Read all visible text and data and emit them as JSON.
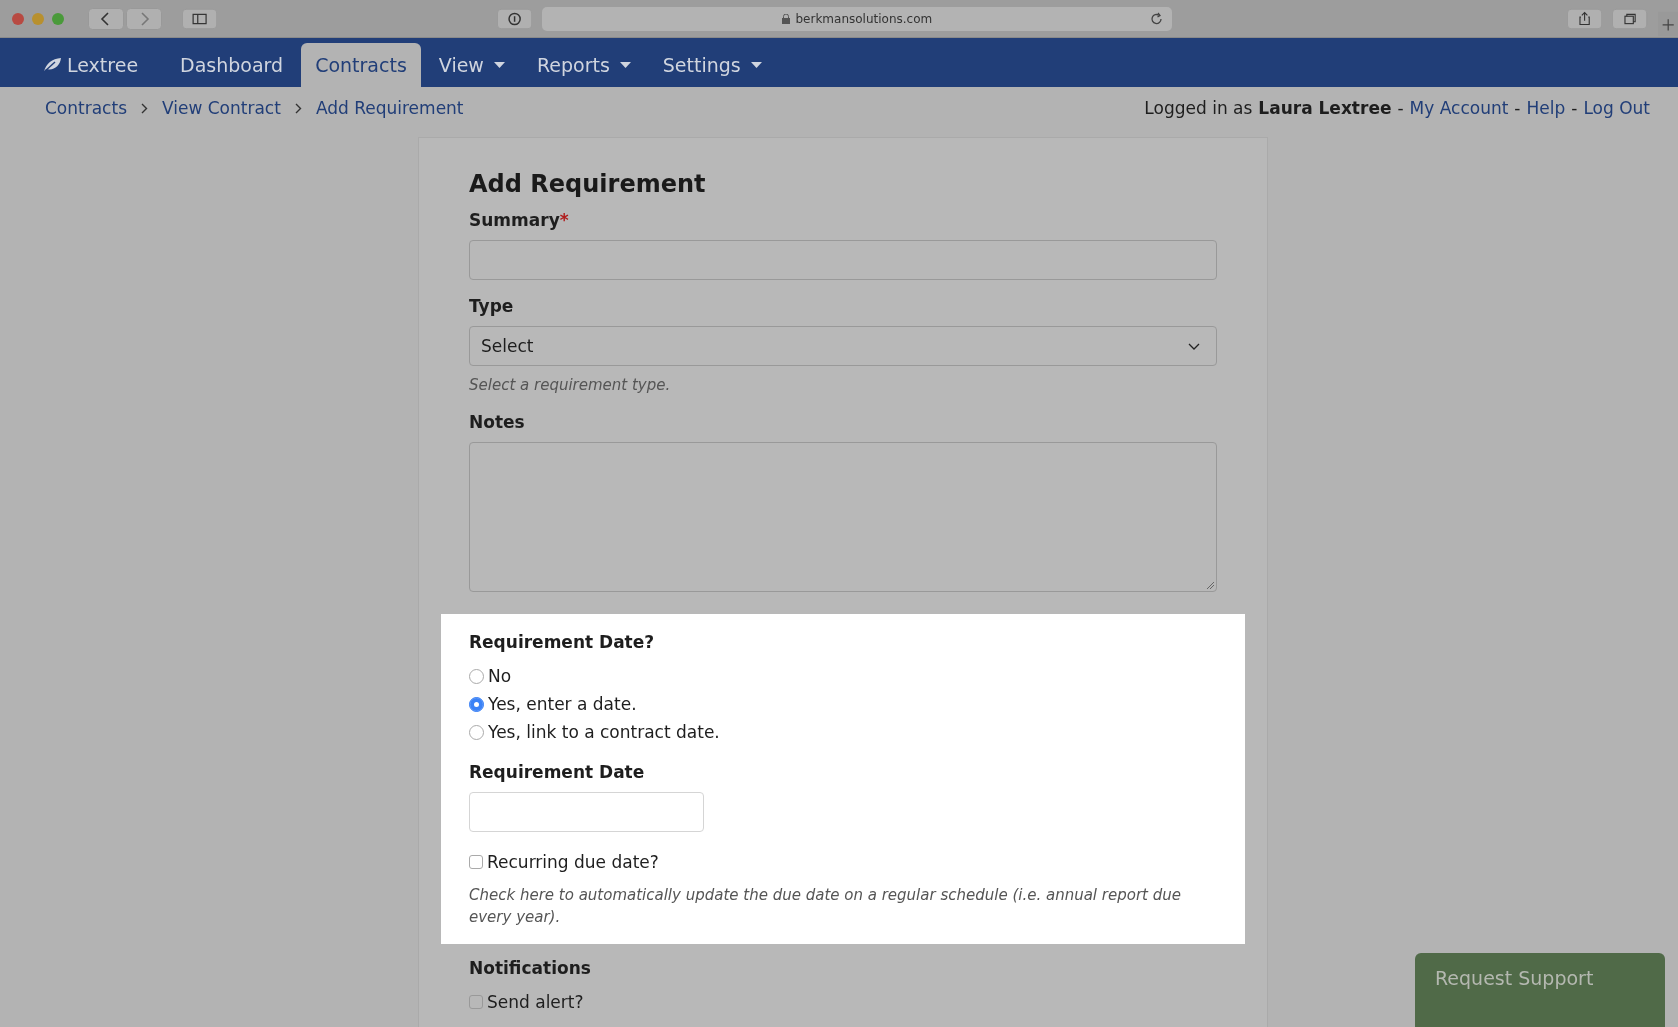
{
  "browser": {
    "url": "berkmansolutions.com"
  },
  "nav": {
    "brand": "Lextree",
    "items": [
      {
        "label": "Dashboard",
        "selected": false,
        "dropdown": false
      },
      {
        "label": "Contracts",
        "selected": true,
        "dropdown": false
      },
      {
        "label": "View",
        "selected": false,
        "dropdown": true
      },
      {
        "label": "Reports",
        "selected": false,
        "dropdown": true
      },
      {
        "label": "Settings",
        "selected": false,
        "dropdown": true
      }
    ]
  },
  "breadcrumb": [
    "Contracts",
    "View Contract",
    "Add Requirement"
  ],
  "user_bar": [
    {
      "kind": "text",
      "text": "Logged in as"
    },
    {
      "kind": "bold",
      "text": "Laura Lextree"
    },
    {
      "kind": "sep",
      "text": "-"
    },
    {
      "kind": "link",
      "text": "My Account"
    },
    {
      "kind": "sep",
      "text": "-"
    },
    {
      "kind": "link",
      "text": "Help"
    },
    {
      "kind": "sep",
      "text": "-"
    },
    {
      "kind": "link",
      "text": "Log Out"
    }
  ],
  "form": {
    "title": "Add Requirement",
    "fields": [
      {
        "kind": "text",
        "label": "Summary",
        "required_mark": "*",
        "highlighted": false
      },
      {
        "kind": "select",
        "label": "Type",
        "value": "Select",
        "hint": "Select a requirement type.",
        "highlighted": false
      },
      {
        "kind": "textarea",
        "label": "Notes",
        "highlighted": false
      },
      {
        "kind": "radio",
        "label": "Requirement Date?",
        "highlighted": true,
        "options": [
          {
            "label": "No",
            "selected": false
          },
          {
            "label": "Yes, enter a date.",
            "selected": true
          },
          {
            "label": "Yes, link to a contract date.",
            "selected": false
          }
        ]
      },
      {
        "kind": "date",
        "label": "Requirement Date",
        "highlighted": true
      },
      {
        "kind": "checkbox",
        "highlighted": true,
        "options": [
          {
            "label": "Recurring due date?",
            "checked": false
          }
        ],
        "hint": "Check here to automatically update the due date on a regular schedule (i.e. annual report due every year)."
      },
      {
        "kind": "checkbox",
        "label": "Notifications",
        "highlighted": false,
        "options": [
          {
            "label": "Send alert?",
            "checked": false
          }
        ]
      }
    ]
  },
  "support_button": "Request Support"
}
